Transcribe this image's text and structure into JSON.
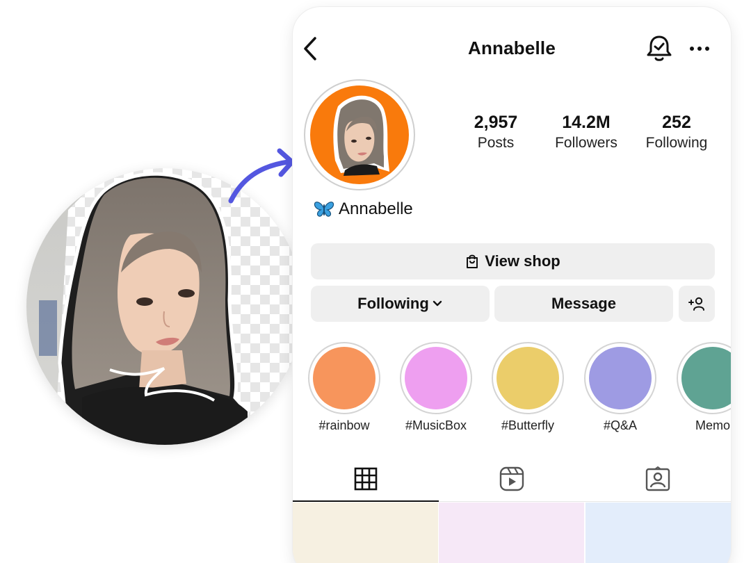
{
  "header": {
    "title": "Annabelle"
  },
  "profile": {
    "display_name": "Annabelle",
    "name_emoji_icon": "butterfly-icon",
    "avatar_bg_color": "#f97a0c",
    "stats": [
      {
        "value": "2,957",
        "label": "Posts"
      },
      {
        "value": "14.2M",
        "label": "Followers"
      },
      {
        "value": "252",
        "label": "Following"
      }
    ]
  },
  "actions": {
    "view_shop": "View shop",
    "following": "Following",
    "message": "Message"
  },
  "highlights": [
    {
      "label": "#rainbow",
      "color": "#f7955c"
    },
    {
      "label": "#MusicBox",
      "color": "#ee9ff0"
    },
    {
      "label": "#Butterfly",
      "color": "#ebcd6a"
    },
    {
      "label": "#Q&A",
      "color": "#9e9be3"
    },
    {
      "label": "Memo",
      "color": "#5fa393"
    }
  ],
  "tabs": [
    {
      "icon": "grid-icon",
      "selected": true
    },
    {
      "icon": "reels-icon",
      "selected": false
    },
    {
      "icon": "tagged-icon",
      "selected": false
    }
  ],
  "grid_cells": [
    {
      "color": "#f6f0e1"
    },
    {
      "color": "#f6e8f7"
    },
    {
      "color": "#e3edfb"
    }
  ],
  "theme": {
    "accent_arrow": "#5457e0",
    "button_bg": "#efefef"
  }
}
